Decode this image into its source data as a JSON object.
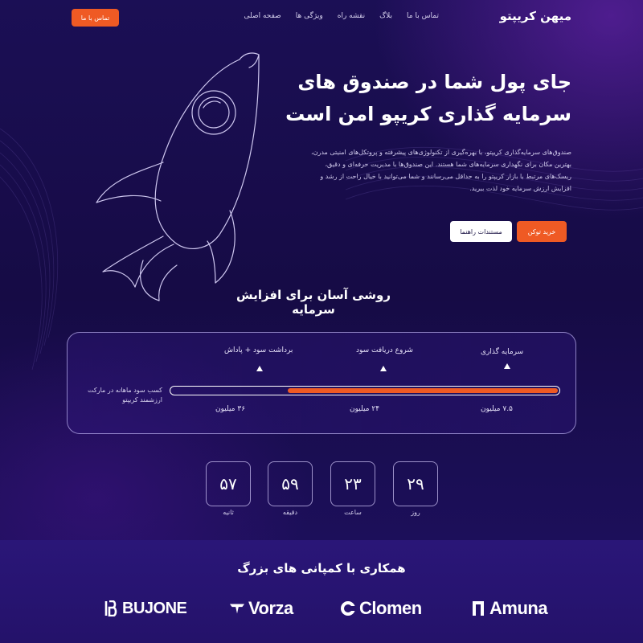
{
  "nav": {
    "logo": "میهن کریپتو",
    "links": [
      "صفحه اصلی",
      "ویژگی ها",
      "نقشه راه",
      "بلاگ",
      "تماس با ما"
    ],
    "cta": "تماس با ما"
  },
  "hero": {
    "headline_line1": "جای پول شما در صندوق های",
    "headline_line2": "سرمایه گذاری کریپو امن است",
    "description": "صندوق‌های سرمایه‌گذاری کریپتو، با بهره‌گیری از تکنولوژی‌های پیشرفته و پروتکل‌های امنیتی مدرن، بهترین مکان برای نگهداری سرمایه‌های شما هستند. این صندوق‌ها با مدیریت حرفه‌ای و دقیق، ریسک‌های مرتبط با بازار کریپتو را به حداقل می‌رسانند و شما می‌توانید با خیال راحت از رشد و افزایش ارزش سرمایه خود لذت ببرید.",
    "buy_button": "خرید توکن",
    "docs_button": "مستندات راهنما"
  },
  "investment": {
    "section_title": "روشی آسان برای افزایش سرمایه",
    "stages": [
      "سرمایه گذاری",
      "شروع دریافت سود",
      "برداشت سود + پاداش"
    ],
    "amounts": [
      "۷.۵ میلیون",
      "۲۴ میلیون",
      "۳۶ میلیون"
    ],
    "progress": 0.7,
    "side_note": "کسب سود ماهانه در مارکت ارزشمند کریپتو"
  },
  "countdown": [
    {
      "value": "۲۹",
      "label": "روز"
    },
    {
      "value": "۲۳",
      "label": "ساعت"
    },
    {
      "value": "۵۹",
      "label": "دقیقه"
    },
    {
      "value": "۵۷",
      "label": "ثانیه"
    }
  ],
  "partners": {
    "title": "همکاری با کمپانی های بزرگ",
    "companies": [
      {
        "name": "BUJONE",
        "icon": "b-monogram-icon"
      },
      {
        "name": "Vorza",
        "icon": "v-wing-icon"
      },
      {
        "name": "Clomen",
        "icon": "c-ring-icon"
      },
      {
        "name": "Amuna",
        "icon": "a-block-icon"
      }
    ]
  },
  "colors": {
    "background": "#170d46",
    "accent": "#ef5a24",
    "footer": "#2a1678"
  }
}
